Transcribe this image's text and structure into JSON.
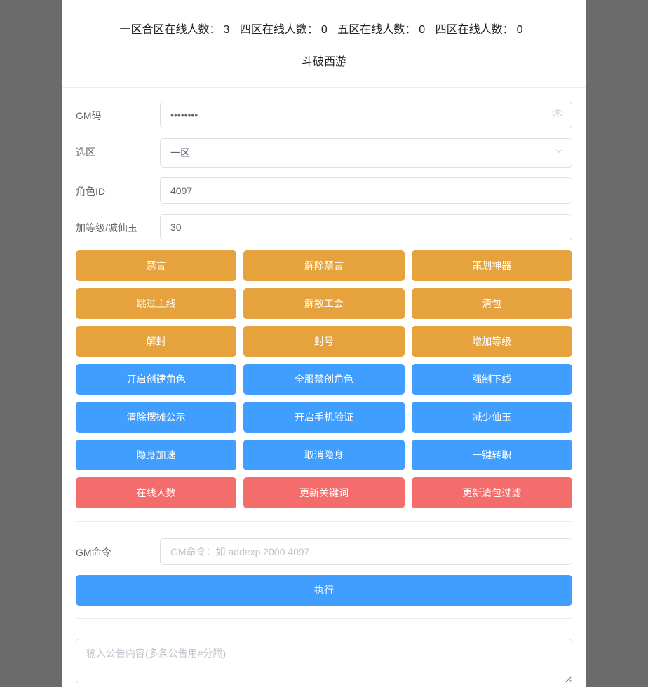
{
  "header": {
    "stats": [
      {
        "label": "一区合区在线人数：",
        "value": "3"
      },
      {
        "label": "四区在线人数：",
        "value": "0"
      },
      {
        "label": "五区在线人数：",
        "value": "0"
      },
      {
        "label": "四区在线人数：",
        "value": "0"
      }
    ],
    "title": "斗破西游"
  },
  "form": {
    "gm_code": {
      "label": "GM码",
      "value": "••••••••"
    },
    "zone": {
      "label": "选区",
      "value": "一区"
    },
    "role_id": {
      "label": "角色ID",
      "value": "4097"
    },
    "level": {
      "label": "加等级/减仙玉",
      "value": "30"
    }
  },
  "buttons": {
    "orange": [
      [
        "禁言",
        "解除禁言",
        "策划神器"
      ],
      [
        "跳过主线",
        "解散工会",
        "清包"
      ],
      [
        "解封",
        "封号",
        "增加等级"
      ]
    ],
    "blue": [
      [
        "开启创建角色",
        "全服禁创角色",
        "强制下线"
      ],
      [
        "清除摆摊公示",
        "开启手机验证",
        "减少仙玉"
      ],
      [
        "隐身加速",
        "取消隐身",
        "一键转职"
      ]
    ],
    "red": [
      [
        "在线人数",
        "更新关键词",
        "更新清包过滤"
      ]
    ]
  },
  "cmd": {
    "label": "GM命令",
    "placeholder": "GM命令：如 addexp 2000 4097",
    "exec": "执行"
  },
  "notice": {
    "placeholder": "输入公告内容(多条公告用#分隔)"
  }
}
